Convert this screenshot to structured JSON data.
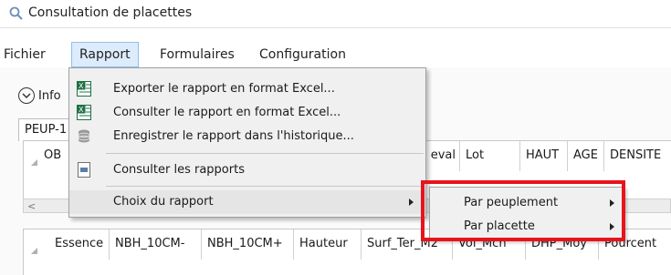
{
  "window": {
    "title": "Consultation de placettes"
  },
  "menubar": {
    "items": [
      "Fichier",
      "Rapport",
      "Formulaires",
      "Configuration"
    ]
  },
  "info": {
    "label": "Info"
  },
  "tab": {
    "label": "PEUP-1"
  },
  "top_grid": {
    "headers": [
      "OB",
      "eval",
      "Lot",
      "HAUT",
      "AGE",
      "DENSITE"
    ]
  },
  "bottom_grid": {
    "headers": [
      "Essence",
      "NBH_10CM-",
      "NBH_10CM+",
      "Hauteur",
      "Surf_Ter_M2",
      "Vol_Mch",
      "DHP_Moy",
      "Pourcent"
    ]
  },
  "rapport_menu": {
    "items": [
      {
        "label": "Exporter le rapport en format Excel...",
        "icon": "excel-icon"
      },
      {
        "label": "Consulter le rapport en format Excel...",
        "icon": "excel-icon"
      },
      {
        "label": "Enregistrer le rapport dans l'historique...",
        "icon": "database-icon"
      },
      {
        "label": "Consulter les rapports",
        "icon": "report-icon"
      },
      {
        "label": "Choix du rapport",
        "icon": ""
      }
    ]
  },
  "submenu": {
    "items": [
      "Par peuplement",
      "Par placette"
    ]
  },
  "colors": {
    "highlight": "#e8141b",
    "hover": "#dcecfc",
    "excel": "#1e7145"
  }
}
